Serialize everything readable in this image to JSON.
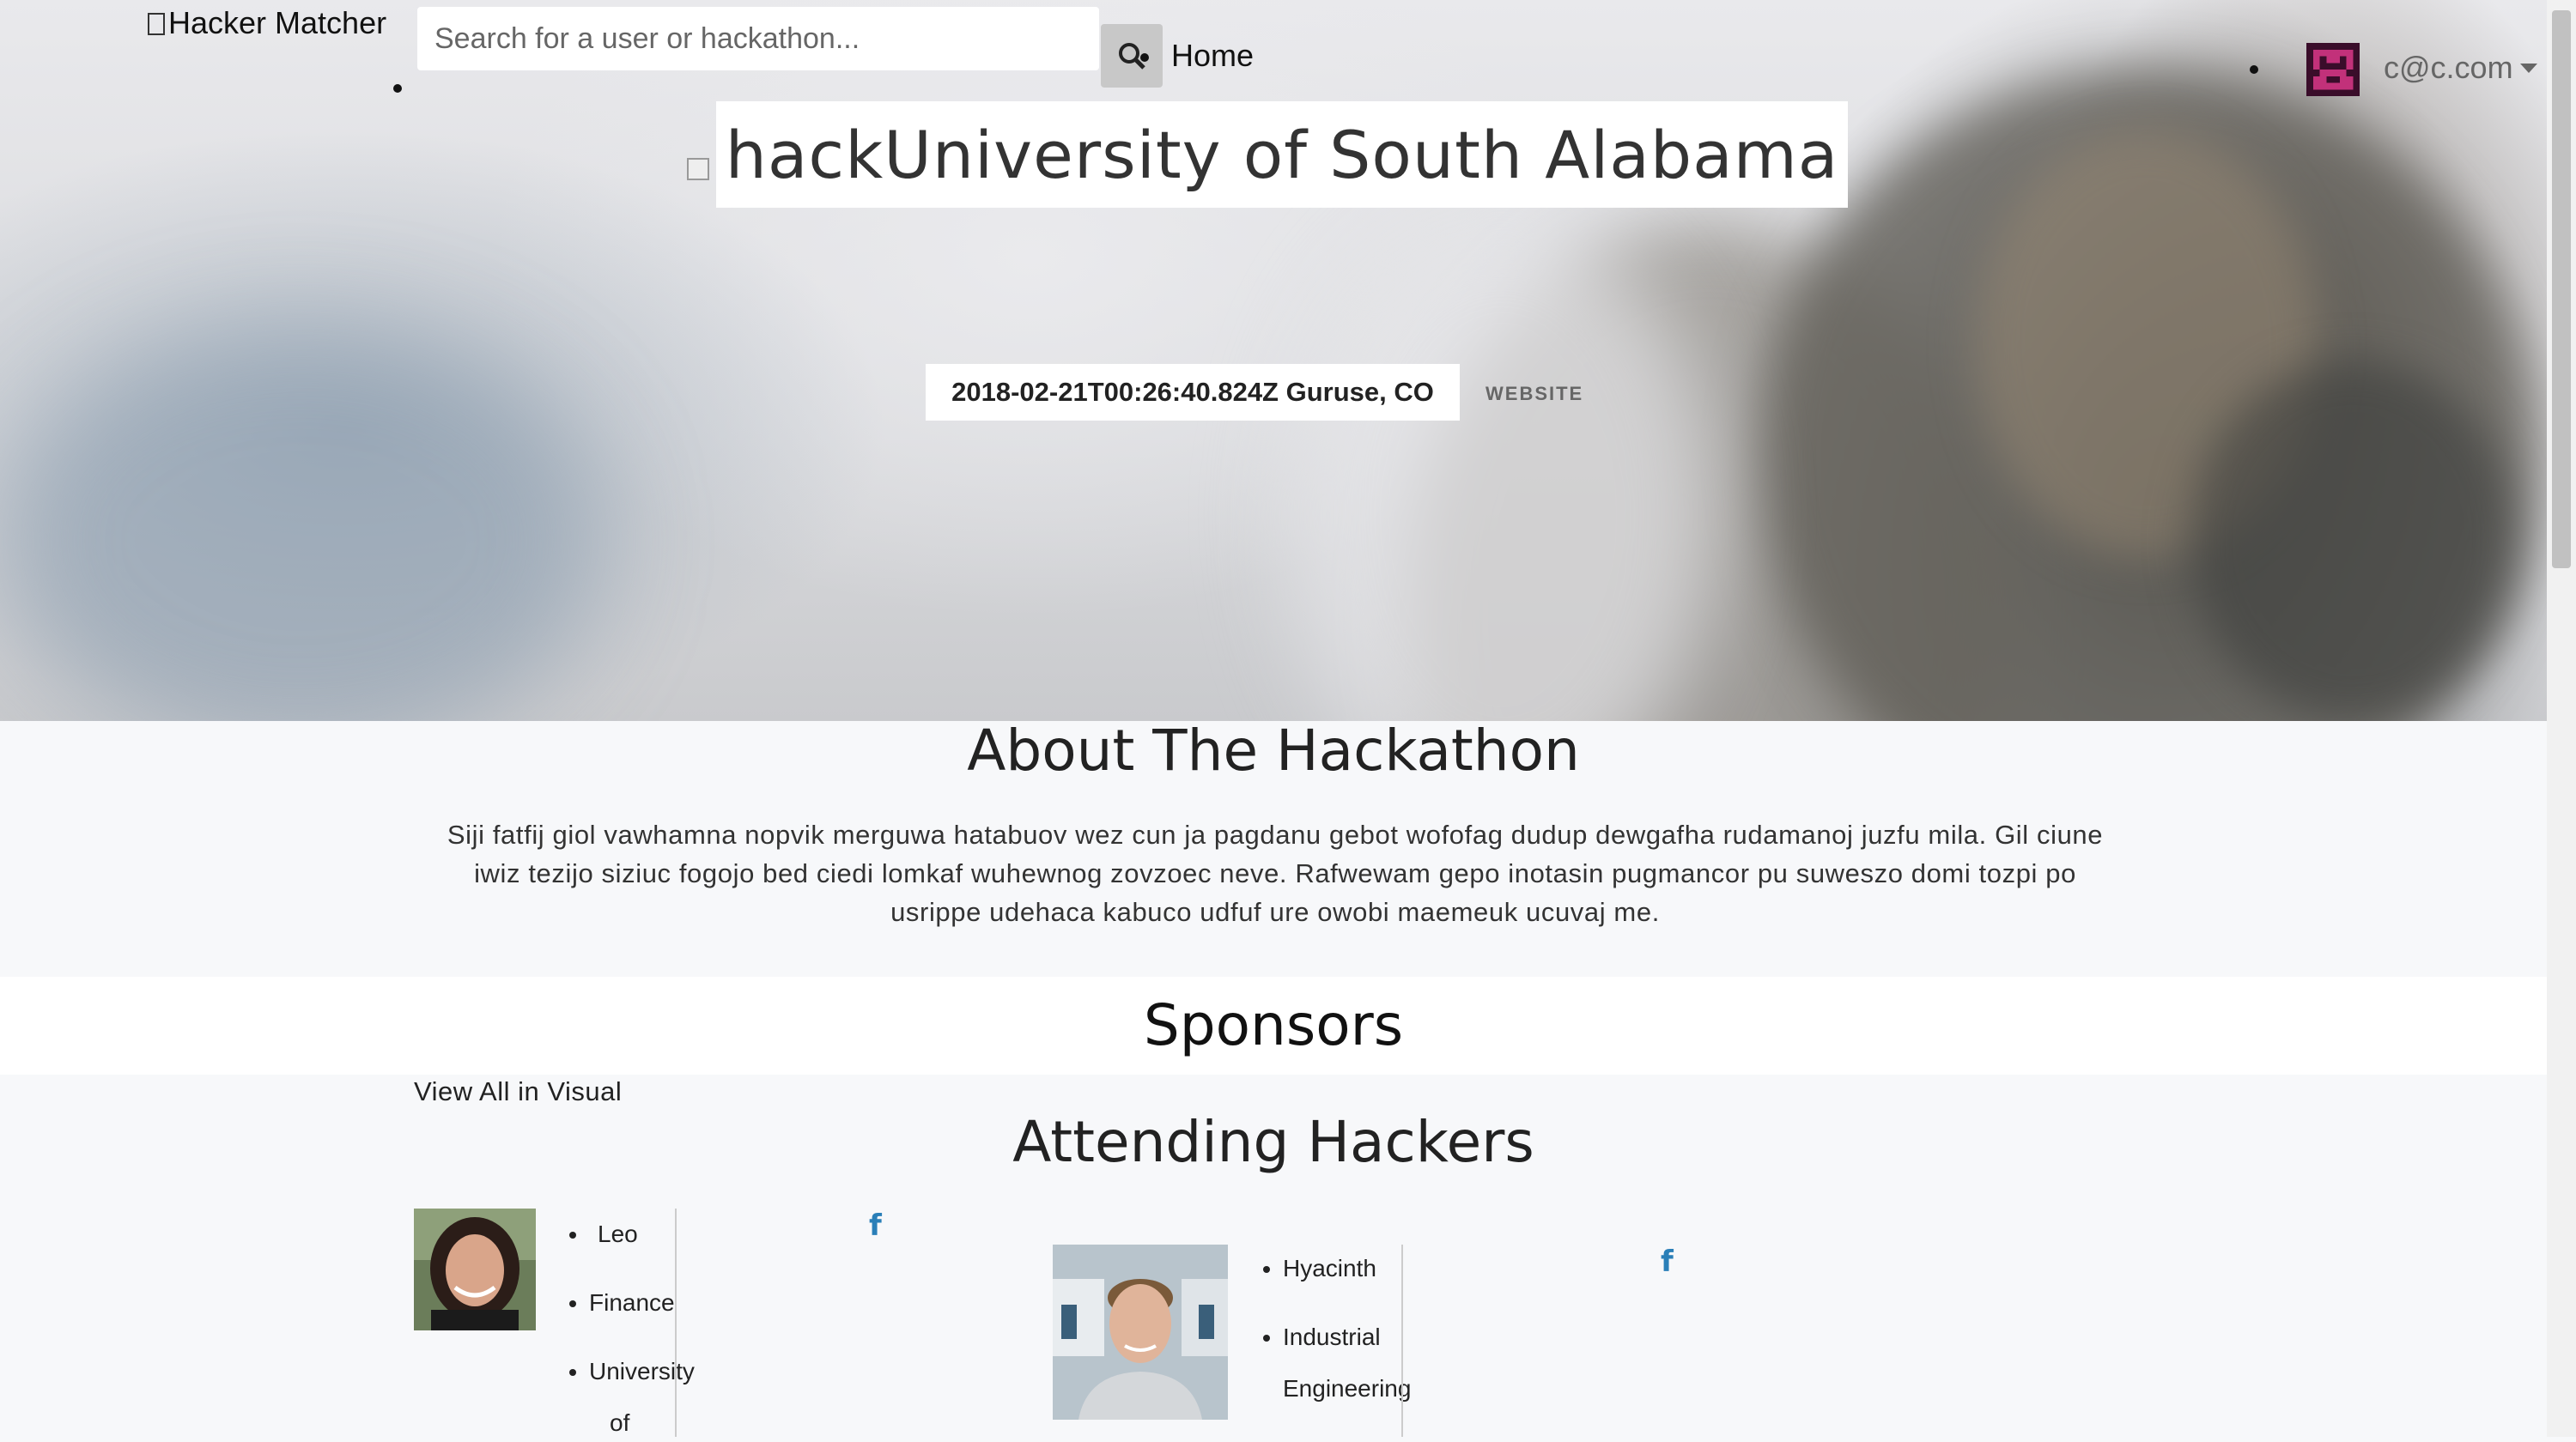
{
  "nav": {
    "brand": "Hacker Matcher",
    "search_placeholder": "Search for a user or hackathon...",
    "home": "Home",
    "user_email": "c@c.com"
  },
  "hero": {
    "title": "hackUniversity of South Alabama",
    "date_location": "2018-02-21T00:26:40.824Z Guruse, CO",
    "website_label": "WEBSITE"
  },
  "about": {
    "heading": "About The Hackathon",
    "text": "Siji fatfij giol vawhamna nopvik merguwa hatabuov wez cun ja pagdanu gebot wofofag dudup dewgafha rudamanoj juzfu mila. Gil ciune iwiz tezijo siziuc fogojo bed ciedi lomkaf wuhewnog zovzoec neve. Rafwewam gepo inotasin pugmancor pu suweszo domi tozpi po usrippe udehaca kabuco udfuf ure owobi maemeuk ucuvaj me."
  },
  "sponsors": {
    "heading": "Sponsors",
    "view_all": "View All in Visual"
  },
  "hackers": {
    "heading": "Attending Hackers",
    "cards": [
      {
        "items": [
          "Leo",
          "Finance",
          "University",
          "of"
        ]
      },
      {
        "items": [
          "Hyacinth",
          "Industrial",
          "Engineering"
        ]
      }
    ]
  },
  "icons": {
    "search": "search-icon",
    "facebook": "facebook-icon",
    "avatar": "avatar"
  }
}
